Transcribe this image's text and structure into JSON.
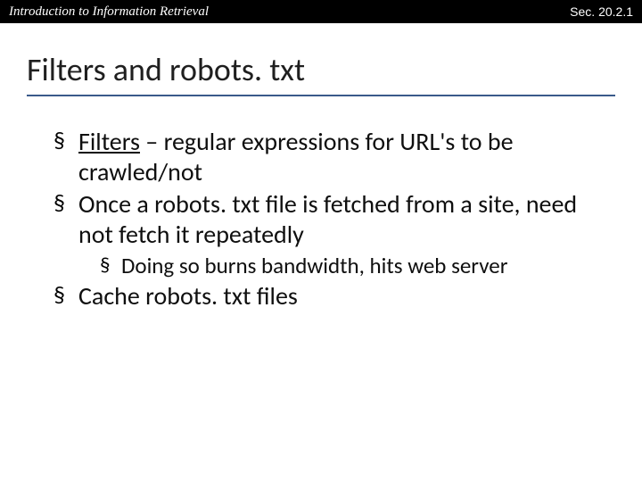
{
  "header": {
    "left": "Introduction to Information Retrieval",
    "right": "Sec. 20.2.1"
  },
  "title": "Filters and robots. txt",
  "bullets": {
    "b1_prefix": "Filters",
    "b1_rest": " – regular expressions for URL's to be crawled/not",
    "b2": "Once a robots. txt file is fetched from a site, need not fetch it repeatedly",
    "b2_sub1": "Doing so burns bandwidth, hits web server",
    "b3": "Cache robots. txt files"
  }
}
